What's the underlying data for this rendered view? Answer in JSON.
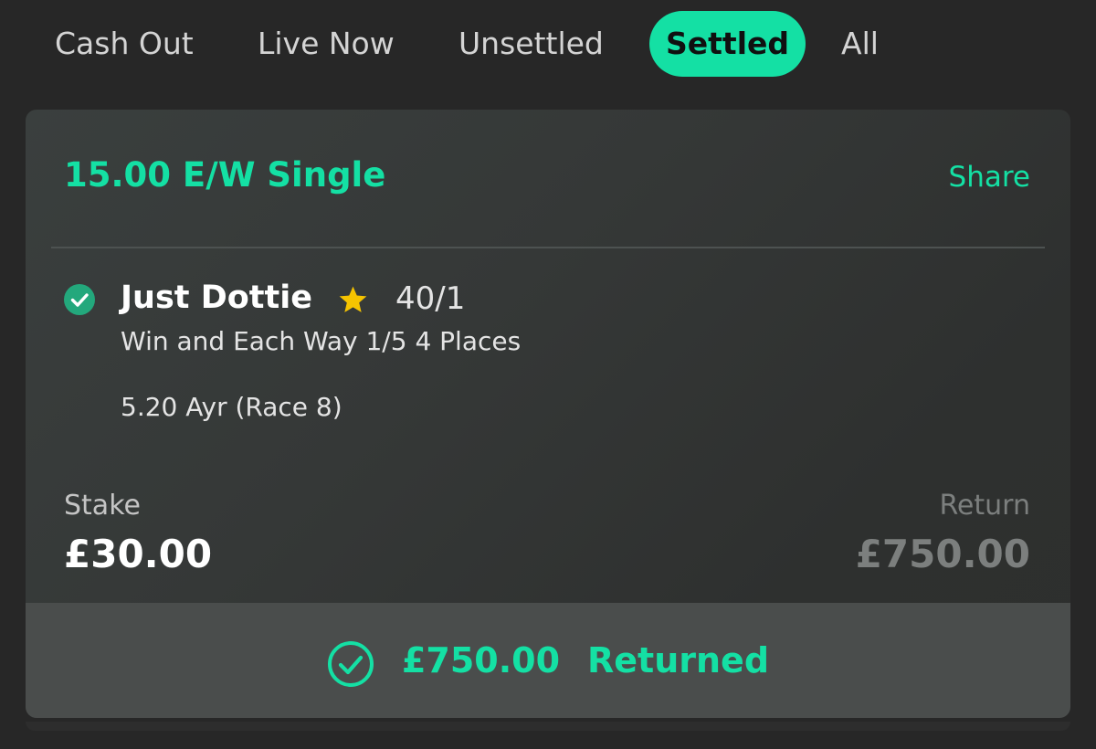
{
  "tabs": [
    {
      "label": "Cash Out",
      "active": false
    },
    {
      "label": "Live Now",
      "active": false
    },
    {
      "label": "Unsettled",
      "active": false
    },
    {
      "label": "Settled",
      "active": true
    },
    {
      "label": "All",
      "active": false
    }
  ],
  "bet": {
    "type": "15.00 E/W Single",
    "share_label": "Share",
    "selection": {
      "name": "Just Dottie",
      "odds": "40/1",
      "market": "Win and Each Way 1/5 4 Places",
      "event": "5.20 Ayr (Race 8)",
      "result_icon": "check-circle-icon",
      "favourite_icon": "star-icon"
    },
    "stake_label": "Stake",
    "stake_value": "£30.00",
    "return_label": "Return",
    "return_value": "£750.00",
    "footer": {
      "amount": "£750.00",
      "status": "Returned",
      "icon": "check-circle-outline-icon"
    }
  },
  "colors": {
    "accent": "#14e0a4",
    "background": "#272727",
    "card": "#363938",
    "footer": "#4a4d4c",
    "star": "#f6c400"
  }
}
